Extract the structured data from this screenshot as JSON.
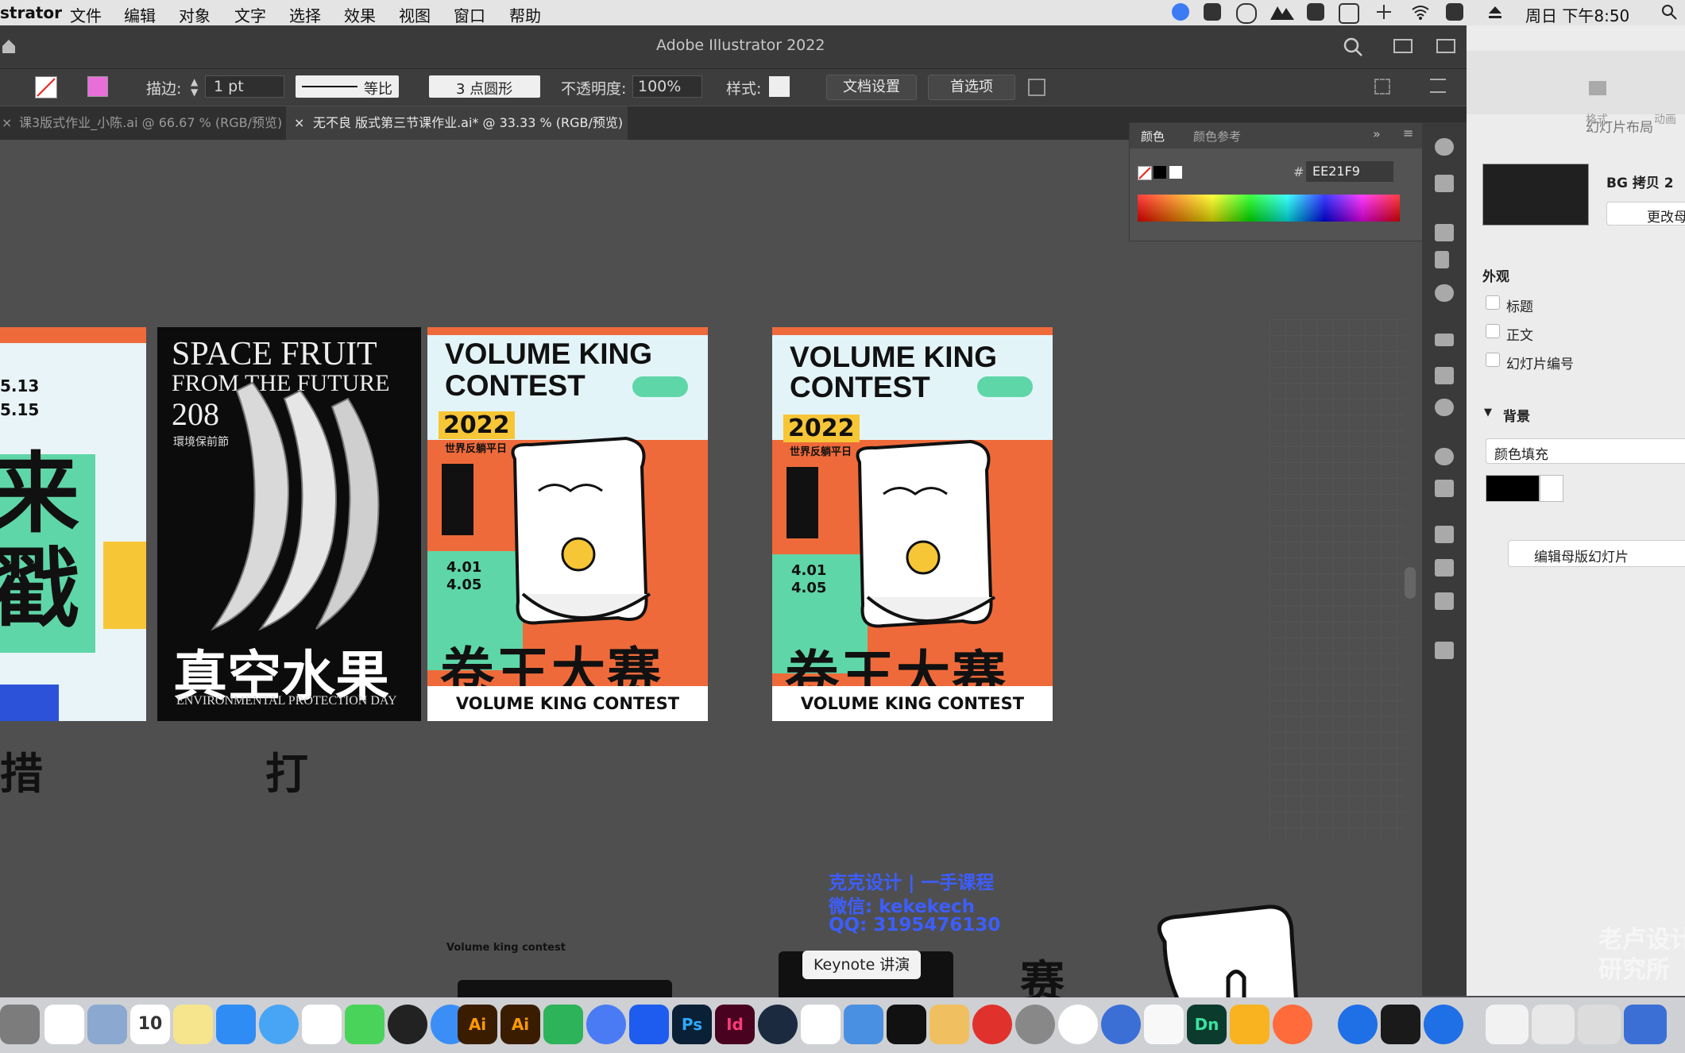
{
  "menubar": {
    "app_name": "strator",
    "items": [
      "文件",
      "编辑",
      "对象",
      "文字",
      "选择",
      "效果",
      "视图",
      "窗口",
      "帮助"
    ],
    "clock": "周日 下午8:50"
  },
  "window": {
    "title": "Adobe Illustrator 2022"
  },
  "control_bar": {
    "stroke_label": "描边:",
    "stroke_value": "1 pt",
    "profile_label": "等比",
    "brush_label": "3 点圆形",
    "opacity_label": "不透明度:",
    "opacity_value": "100%",
    "style_label": "样式:",
    "doc_setup_button": "文档设置",
    "prefs_button": "首选项"
  },
  "tabs": [
    {
      "label": "课3版式作业_小陈.ai @ 66.67 % (RGB/预览)",
      "active": false
    },
    {
      "label": "无不良 版式第三节课作业.ai* @ 33.33 % (RGB/预览)",
      "active": true
    }
  ],
  "color_panel": {
    "tab_color": "颜色",
    "tab_guide": "颜色参考",
    "hex_symbol": "#",
    "hex_value": "EE21F9"
  },
  "posters": {
    "left": {
      "date1": "5.13",
      "date2": "5.15",
      "big1": "来",
      "big2": "戳"
    },
    "space_fruit": {
      "line1": "SPACE FRUIT",
      "line2": "FROM THE FUTURE",
      "year": "208",
      "cn_small": "環境保前節",
      "cn_big": "真空水果",
      "footer": "ENVIRONMENTAL PROTECTION DAY"
    },
    "volume_king": {
      "title1": "VOLUME KING",
      "title2": "CONTEST",
      "year": "2022",
      "subtitle": "世界反躺平日",
      "date1": "4.01",
      "date2": "4.05",
      "cn_big": "卷王大赛",
      "footer": "VOLUME KING CONTEST"
    }
  },
  "canvas_text": {
    "under_left": "措",
    "under_space": "打",
    "overlay_line1": "克克设计 | 一手课程",
    "overlay_line2": "微信: kekekech",
    "overlay_line3": "QQ: 3195476130",
    "small_label": "Volume king contest",
    "bottom_big": "赛"
  },
  "keynote_panel": {
    "tab_format": "格式",
    "tab_anim": "动画",
    "header": "幻灯片布局",
    "layout_name": "BG 拷贝 2",
    "change_button": "更改母",
    "appearance": "外观",
    "chk_title": "标题",
    "chk_body": "正文",
    "chk_number": "幻灯片编号",
    "background": "背景",
    "fill_select": "颜色填充",
    "edit_master": "编辑母版幻灯片",
    "watermark1": "老卢设计",
    "watermark2": "研究所"
  },
  "dock": {
    "tooltip": "Keynote 讲演",
    "calendar_day": "10",
    "apps": [
      "Ai",
      "Ai",
      "Ps",
      "Id",
      "Dn"
    ]
  },
  "colors": {
    "accent_green": "#5fd6a8",
    "accent_orange": "#ef6a3a",
    "accent_yellow": "#f7c636",
    "selected_color": "#EE21F9"
  }
}
